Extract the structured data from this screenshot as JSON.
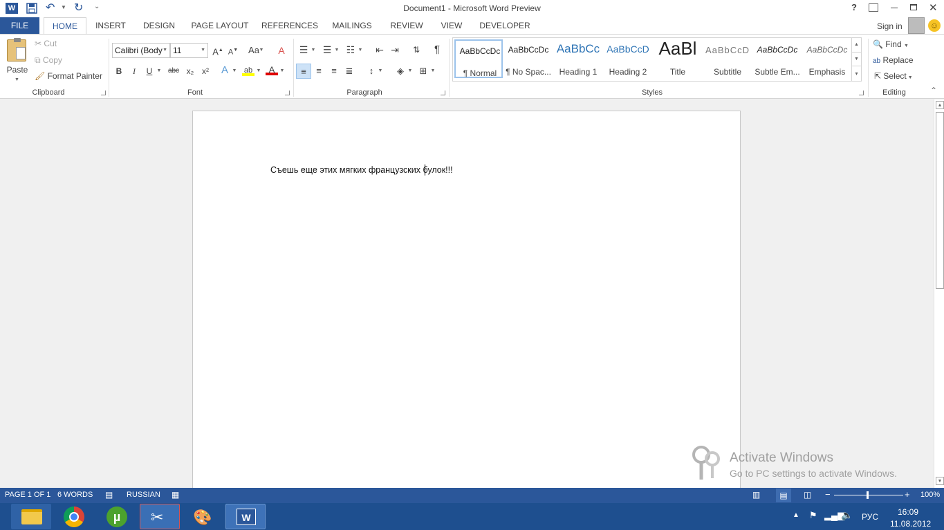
{
  "title_bar": {
    "window_title": "Document1 - Microsoft Word Preview",
    "help": "?",
    "qat_more": "⌄"
  },
  "tabs": [
    {
      "label": "FILE"
    },
    {
      "label": "HOME"
    },
    {
      "label": "INSERT"
    },
    {
      "label": "DESIGN"
    },
    {
      "label": "PAGE LAYOUT"
    },
    {
      "label": "REFERENCES"
    },
    {
      "label": "MAILINGS"
    },
    {
      "label": "REVIEW"
    },
    {
      "label": "VIEW"
    },
    {
      "label": "DEVELOPER"
    }
  ],
  "account": {
    "sign_in": "Sign in"
  },
  "clipboard": {
    "paste": "Paste",
    "cut": "Cut",
    "copy": "Copy",
    "format_painter": "Format Painter",
    "group_label": "Clipboard"
  },
  "font": {
    "font_name": "Calibri (Body",
    "font_size": "11",
    "case": "Aa",
    "bold": "B",
    "italic": "I",
    "underline": "U",
    "strike": "abc",
    "subscript": "x₂",
    "superscript": "x²",
    "group_label": "Font"
  },
  "paragraph": {
    "pilcrow": "¶",
    "group_label": "Paragraph"
  },
  "styles": {
    "items": [
      {
        "preview": "AaBbCcDc",
        "name": "¶ Normal"
      },
      {
        "preview": "AaBbCcDc",
        "name": "¶ No Spac..."
      },
      {
        "preview": "AaBbCc",
        "name": "Heading 1"
      },
      {
        "preview": "AaBbCcD",
        "name": "Heading 2"
      },
      {
        "preview": "AaBl",
        "name": "Title"
      },
      {
        "preview": "AaBbCcD",
        "name": "Subtitle"
      },
      {
        "preview": "AaBbCcDc",
        "name": "Subtle Em..."
      },
      {
        "preview": "AaBbCcDc",
        "name": "Emphasis"
      }
    ],
    "group_label": "Styles"
  },
  "editing": {
    "find": "Find",
    "replace": "Replace",
    "select": "Select",
    "group_label": "Editing"
  },
  "document": {
    "text": "Съешь еще этих мягких французских булок!!!"
  },
  "watermark": {
    "title": "Activate Windows",
    "subtitle": "Go to PC settings to activate Windows."
  },
  "status_bar": {
    "page": "PAGE 1 OF 1",
    "words": "6 WORDS",
    "language": "RUSSIAN",
    "zoom": "100%",
    "zoom_level_percent": 100
  },
  "taskbar": {
    "language": "РУС",
    "time": "16:09",
    "date": "11.08.2012",
    "apps": [
      "file-explorer",
      "chrome",
      "utorrent",
      "scissors-app",
      "paint",
      "word"
    ]
  },
  "colors": {
    "accent": "#2b579a",
    "taskbar": "#1e4f8f",
    "highlight": "#cde2f7"
  }
}
